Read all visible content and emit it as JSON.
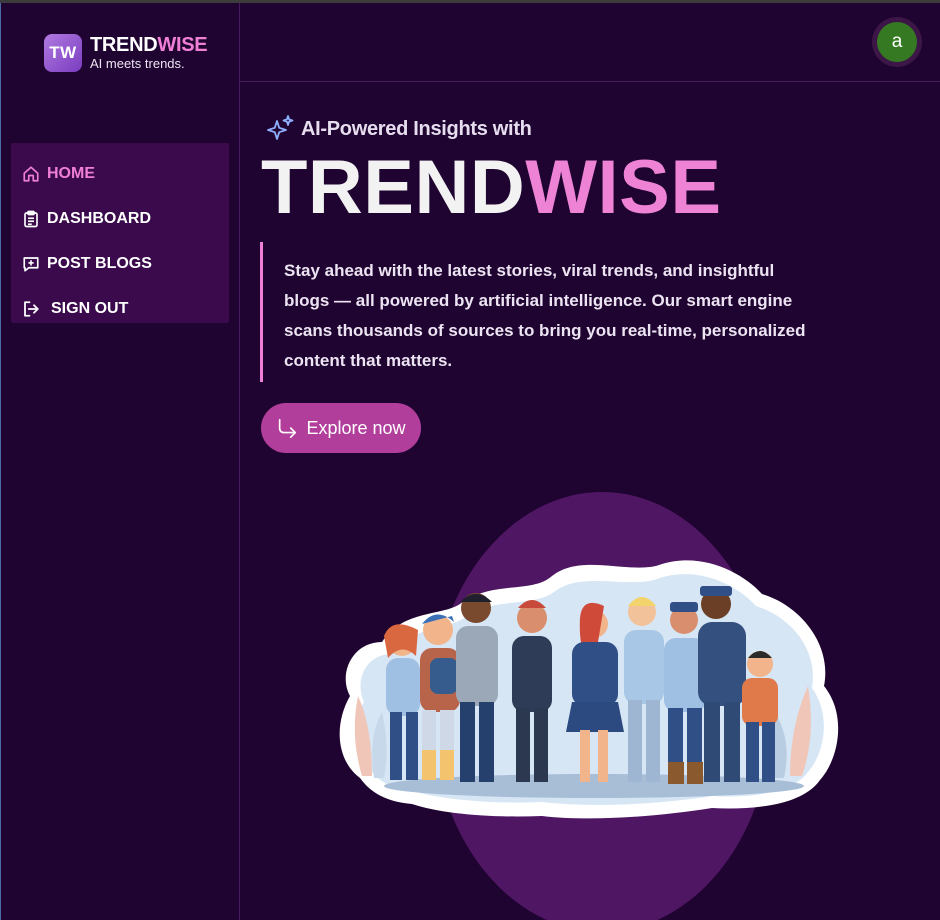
{
  "brand": {
    "logo_text": "TW",
    "name_part1": "TREND",
    "name_part2": "WISE",
    "tagline": "AI meets trends."
  },
  "nav": {
    "items": [
      {
        "label": "HOME",
        "icon": "home-icon",
        "active": true
      },
      {
        "label": "DASHBOARD",
        "icon": "clipboard-icon",
        "active": false
      },
      {
        "label": "POST BLOGS",
        "icon": "message-plus-icon",
        "active": false
      },
      {
        "label": "SIGN OUT",
        "icon": "sign-out-icon",
        "active": false
      }
    ]
  },
  "header": {
    "avatar_letter": "a"
  },
  "hero": {
    "kicker": "AI-Powered Insights with",
    "title_part1": "TREND",
    "title_part2": "WISE",
    "description": "Stay ahead with the latest stories, viral trends, and insightful blogs — all powered by artificial intelligence. Our smart engine scans thousands of sources to bring you real-time, personalized content that matters.",
    "cta_label": "Explore now",
    "illustration": "diverse-crowd-illustration"
  },
  "colors": {
    "background": "#1f0330",
    "accent_pink": "#f07fd6",
    "button": "#b23e9b",
    "nav_bg": "#3a0a4c",
    "avatar_bg": "#357a22"
  }
}
